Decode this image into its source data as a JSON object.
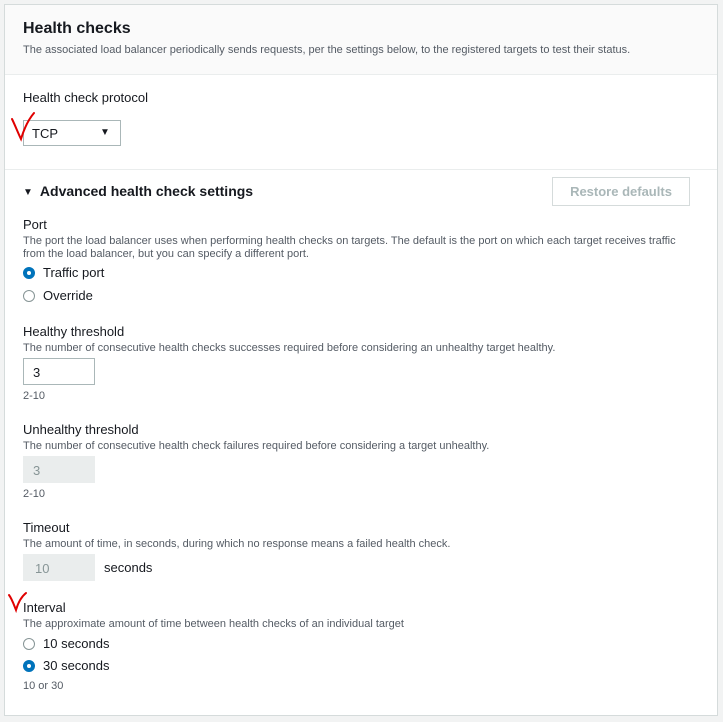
{
  "header": {
    "title": "Health checks",
    "subtitle": "The associated load balancer periodically sends requests, per the settings below, to the registered targets to test their status."
  },
  "protocol": {
    "label": "Health check protocol",
    "value": "TCP"
  },
  "advanced": {
    "label": "Advanced health check settings",
    "restore_label": "Restore defaults"
  },
  "port": {
    "label": "Port",
    "description_line1": "The port the load balancer uses when performing health checks on targets. The default is the port on which each target receives traffic",
    "description_line2": "from the load balancer, but you can specify a different port.",
    "options": [
      "Traffic port",
      "Override"
    ],
    "selected": "Traffic port"
  },
  "healthy_threshold": {
    "label": "Healthy threshold",
    "description": "The number of consecutive health checks successes required before considering an unhealthy target healthy.",
    "value": "3",
    "hint": "2-10"
  },
  "unhealthy_threshold": {
    "label": "Unhealthy threshold",
    "description": "The number of consecutive health check failures required before considering a target unhealthy.",
    "value": "3",
    "hint": "2-10"
  },
  "timeout": {
    "label": "Timeout",
    "description": "The amount of time, in seconds, during which no response means a failed health check.",
    "value": "10",
    "unit": "seconds"
  },
  "interval": {
    "label": "Interval",
    "description": "The approximate amount of time between health checks of an individual target",
    "options": [
      "10 seconds",
      "30 seconds"
    ],
    "selected": "30 seconds",
    "hint": "10 or 30"
  },
  "colors": {
    "accent": "#0073bb",
    "annotation": "#e00000"
  }
}
